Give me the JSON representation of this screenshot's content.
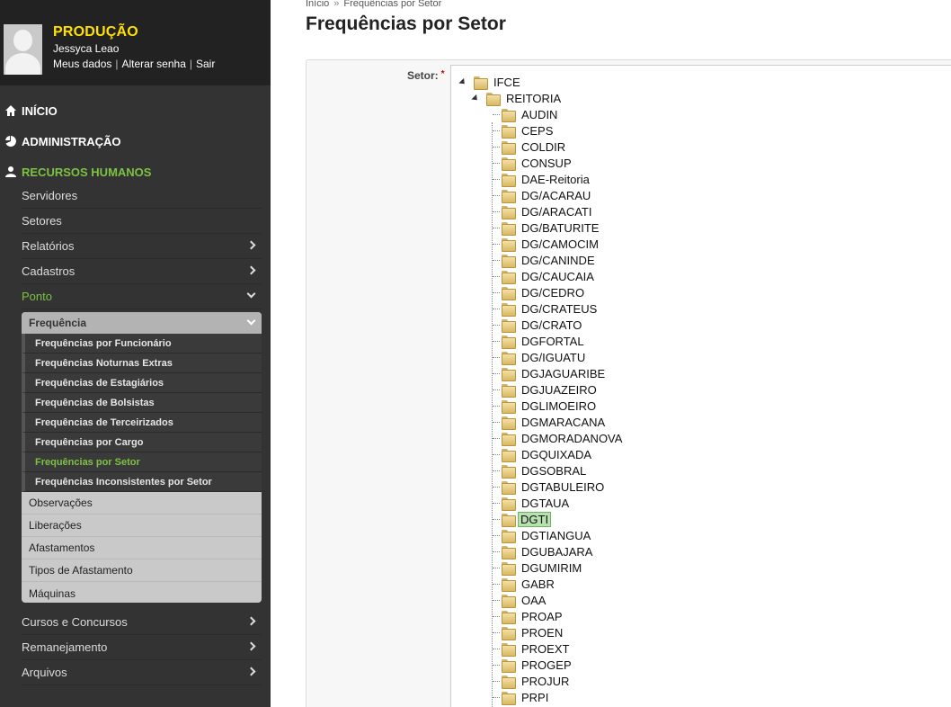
{
  "profile": {
    "environment": "PRODUÇÃO",
    "name": "Jessyca Leao",
    "links": [
      "Meus dados",
      "Alterar senha",
      "Sair"
    ]
  },
  "nav": {
    "top": [
      {
        "label": "INÍCIO",
        "icon": "home-icon"
      },
      {
        "label": "ADMINISTRAÇÃO",
        "icon": "pie-chart-icon"
      },
      {
        "label": "RECURSOS HUMANOS",
        "icon": "user-icon"
      }
    ],
    "hr_items": [
      "Servidores",
      "Setores",
      "Relatórios",
      "Cadastros",
      "Ponto"
    ],
    "frequencia_label": "Frequência",
    "frequencia_items": [
      "Frequências por Funcionário",
      "Frequências Noturnas Extras",
      "Frequências de Estagiários",
      "Frequências de Bolsistas",
      "Frequências de Terceirizados",
      "Frequências por Cargo",
      "Frequências por Setor",
      "Frequências Inconsistentes por Setor"
    ],
    "ponto_items": [
      "Observações",
      "Liberações",
      "Afastamentos",
      "Tipos de Afastamento",
      "Máquinas"
    ],
    "bottom_items": [
      "Cursos e Concursos",
      "Remanejamento",
      "Arquivos"
    ]
  },
  "breadcrumb": {
    "home": "Início",
    "separator": "»",
    "current": "Frequências por Setor"
  },
  "page_title": "Frequências por Setor",
  "form": {
    "setor_label": "Setor:",
    "required_mark": "*",
    "tree": {
      "root": "IFCE",
      "child": "REITORIA",
      "selected": "DGTI",
      "items": [
        "AUDIN",
        "CEPS",
        "COLDIR",
        "CONSUP",
        "DAE-Reitoria",
        "DG/ACARAU",
        "DG/ARACATI",
        "DG/BATURITE",
        "DG/CAMOCIM",
        "DG/CANINDE",
        "DG/CAUCAIA",
        "DG/CEDRO",
        "DG/CRATEUS",
        "DG/CRATO",
        "DGFORTAL",
        "DG/IGUATU",
        "DGJAGUARIBE",
        "DGJUAZEIRO",
        "DGLIMOEIRO",
        "DGMARACANA",
        "DGMORADANOVA",
        "DGQUIXADA",
        "DGSOBRAL",
        "DGTABULEIRO",
        "DGTAUA",
        "DGTI",
        "DGTIANGUA",
        "DGUBAJARA",
        "DGUMIRIM",
        "GABR",
        "OAA",
        "PROAP",
        "PROEN",
        "PROEXT",
        "PROGEP",
        "PROJUR",
        "PRPI"
      ]
    }
  },
  "colors": {
    "accent_green": "#7dc243",
    "env_yellow": "#ffe000",
    "sidebar_bg": "#333333"
  }
}
